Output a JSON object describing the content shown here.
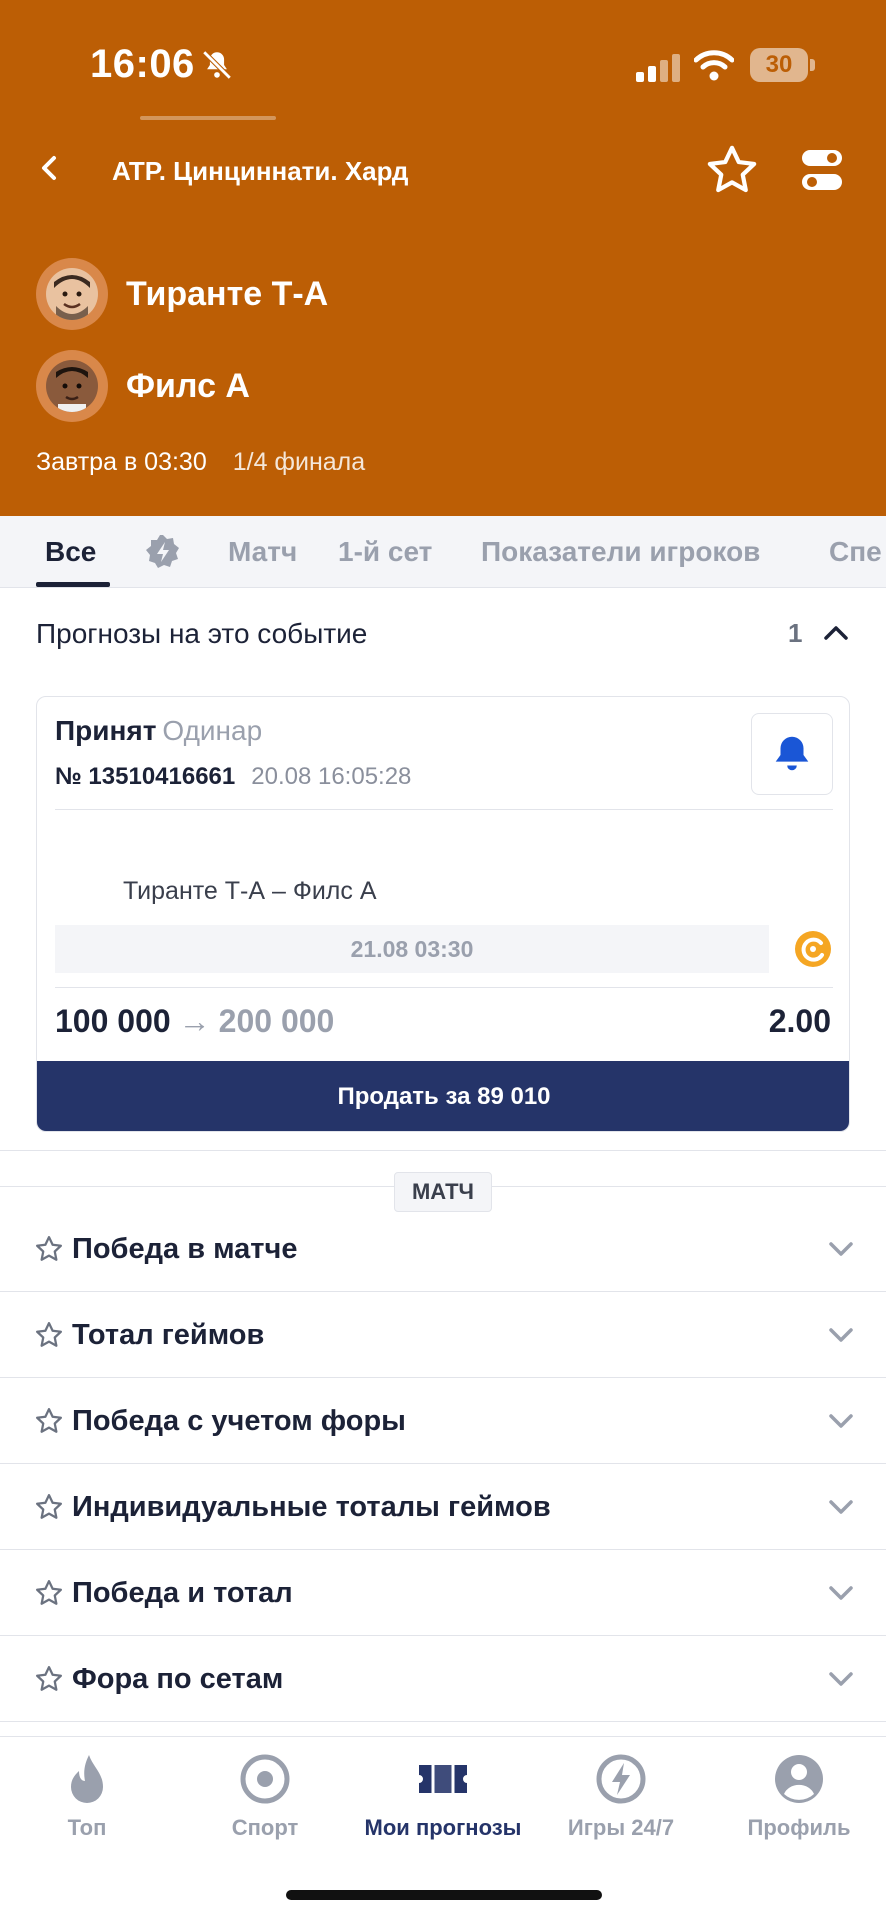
{
  "status_bar": {
    "time": "16:06",
    "battery": "30"
  },
  "header": {
    "title": "ATP. Цинциннати. Хард",
    "player1": "Тиранте Т-А",
    "player2": "Филс А",
    "start_time": "Завтра в 03:30",
    "stage": "1/4 финала",
    "bg_color": "#bc5e05"
  },
  "tabs": [
    {
      "label": "Все",
      "active": true
    },
    {
      "label": "Матч"
    },
    {
      "label": "1-й сет"
    },
    {
      "label": "Показатели игроков"
    },
    {
      "label": "Спе"
    }
  ],
  "predictions": {
    "title": "Прогнозы на это событие",
    "count": "1",
    "card": {
      "status": "Принят",
      "type": "Одинар",
      "number": "№ 13510416661",
      "date": "20.08   16:05:28",
      "event": "Тиранте Т-А – Филс А",
      "event_date": "21.08 03:30",
      "stake": "100 000",
      "arrow": "→",
      "win": "200 000",
      "odds": "2.00",
      "sell_label": "Продать за 89 010"
    }
  },
  "markets": {
    "section_label": "МАТЧ",
    "items": [
      "Победа в матче",
      "Тотал геймов",
      "Победа с учетом форы",
      "Индивидуальные тоталы геймов",
      "Победа и тотал",
      "Фора по сетам"
    ]
  },
  "bottom_nav": [
    {
      "label": "Топ",
      "icon": "flame-icon"
    },
    {
      "label": "Спорт",
      "icon": "sport-icon"
    },
    {
      "label": "Мои прогнозы",
      "icon": "ticket-icon",
      "active": true
    },
    {
      "label": "Игры 24/7",
      "icon": "lightning-icon"
    },
    {
      "label": "Профиль",
      "icon": "profile-icon"
    }
  ],
  "colors": {
    "accent": "#253469",
    "header": "#bc5e05",
    "live": "#f5a623",
    "bell": "#1a56d6"
  }
}
